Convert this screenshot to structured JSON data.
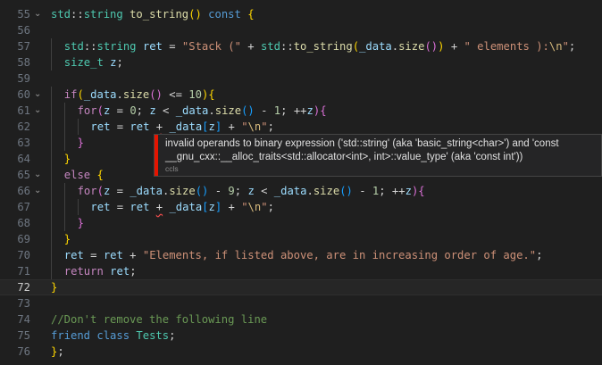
{
  "editor": {
    "current_line": "72",
    "lines": [
      {
        "n": "55",
        "fold": "⌄",
        "indent": 0,
        "tokens": [
          [
            "ns",
            "std"
          ],
          [
            "op",
            "::"
          ],
          [
            "ty",
            "string"
          ],
          [
            "op",
            " "
          ],
          [
            "fn",
            "to_string"
          ],
          [
            "p1",
            "()"
          ],
          [
            "op",
            " "
          ],
          [
            "kw",
            "const"
          ],
          [
            "op",
            " "
          ],
          [
            "p1",
            "{"
          ]
        ]
      },
      {
        "n": "56",
        "fold": "",
        "indent": 0,
        "tokens": []
      },
      {
        "n": "57",
        "fold": "",
        "indent": 1,
        "tokens": [
          [
            "ns",
            "std"
          ],
          [
            "op",
            "::"
          ],
          [
            "ty",
            "string"
          ],
          [
            "op",
            " "
          ],
          [
            "var",
            "ret"
          ],
          [
            "op",
            " = "
          ],
          [
            "str",
            "\"Stack (\""
          ],
          [
            "op",
            " + "
          ],
          [
            "ns",
            "std"
          ],
          [
            "op",
            "::"
          ],
          [
            "fn",
            "to_string"
          ],
          [
            "p1",
            "("
          ],
          [
            "var",
            "_data"
          ],
          [
            "op",
            "."
          ],
          [
            "fn",
            "size"
          ],
          [
            "p2",
            "()"
          ],
          [
            "p1",
            ")"
          ],
          [
            "op",
            " + "
          ],
          [
            "str",
            "\" elements ):"
          ],
          [
            "esc",
            "\\n"
          ],
          [
            "str",
            "\""
          ],
          [
            "op",
            ";"
          ]
        ]
      },
      {
        "n": "58",
        "fold": "",
        "indent": 1,
        "tokens": [
          [
            "ty",
            "size_t"
          ],
          [
            "op",
            " "
          ],
          [
            "var",
            "z"
          ],
          [
            "op",
            ";"
          ]
        ]
      },
      {
        "n": "59",
        "fold": "",
        "indent": 0,
        "tokens": []
      },
      {
        "n": "60",
        "fold": "⌄",
        "indent": 1,
        "tokens": [
          [
            "ctl",
            "if"
          ],
          [
            "p1",
            "("
          ],
          [
            "var",
            "_data"
          ],
          [
            "op",
            "."
          ],
          [
            "fn",
            "size"
          ],
          [
            "p2",
            "()"
          ],
          [
            "op",
            " <= "
          ],
          [
            "num",
            "10"
          ],
          [
            "p1",
            ")"
          ],
          [
            "p1",
            "{"
          ]
        ]
      },
      {
        "n": "61",
        "fold": "⌄",
        "indent": 2,
        "tokens": [
          [
            "ctl",
            "for"
          ],
          [
            "p2",
            "("
          ],
          [
            "var",
            "z"
          ],
          [
            "op",
            " = "
          ],
          [
            "num",
            "0"
          ],
          [
            "op",
            "; "
          ],
          [
            "var",
            "z"
          ],
          [
            "op",
            " < "
          ],
          [
            "var",
            "_data"
          ],
          [
            "op",
            "."
          ],
          [
            "fn",
            "size"
          ],
          [
            "p3",
            "()"
          ],
          [
            "op",
            " - "
          ],
          [
            "num",
            "1"
          ],
          [
            "op",
            "; ++"
          ],
          [
            "var",
            "z"
          ],
          [
            "p2",
            ")"
          ],
          [
            "p2",
            "{"
          ]
        ]
      },
      {
        "n": "62",
        "fold": "",
        "indent": 3,
        "tokens": [
          [
            "var",
            "ret"
          ],
          [
            "op",
            " = "
          ],
          [
            "var",
            "ret"
          ],
          [
            "op",
            " "
          ],
          [
            "sq",
            "+"
          ],
          [
            "op",
            " "
          ],
          [
            "var",
            "_data"
          ],
          [
            "p3",
            "["
          ],
          [
            "var",
            "z"
          ],
          [
            "p3",
            "]"
          ],
          [
            "op",
            " + "
          ],
          [
            "str",
            "\""
          ],
          [
            "esc",
            "\\n"
          ],
          [
            "str",
            "\""
          ],
          [
            "op",
            ";"
          ]
        ]
      },
      {
        "n": "63",
        "fold": "",
        "indent": 2,
        "tokens": [
          [
            "p2",
            "}"
          ]
        ]
      },
      {
        "n": "64",
        "fold": "",
        "indent": 1,
        "tokens": [
          [
            "p1",
            "}"
          ]
        ]
      },
      {
        "n": "65",
        "fold": "⌄",
        "indent": 1,
        "tokens": [
          [
            "ctl",
            "else"
          ],
          [
            "op",
            " "
          ],
          [
            "p1",
            "{"
          ]
        ]
      },
      {
        "n": "66",
        "fold": "⌄",
        "indent": 2,
        "tokens": [
          [
            "ctl",
            "for"
          ],
          [
            "p2",
            "("
          ],
          [
            "var",
            "z"
          ],
          [
            "op",
            " = "
          ],
          [
            "var",
            "_data"
          ],
          [
            "op",
            "."
          ],
          [
            "fn",
            "size"
          ],
          [
            "p3",
            "()"
          ],
          [
            "op",
            " - "
          ],
          [
            "num",
            "9"
          ],
          [
            "op",
            "; "
          ],
          [
            "var",
            "z"
          ],
          [
            "op",
            " < "
          ],
          [
            "var",
            "_data"
          ],
          [
            "op",
            "."
          ],
          [
            "fn",
            "size"
          ],
          [
            "p3",
            "()"
          ],
          [
            "op",
            " - "
          ],
          [
            "num",
            "1"
          ],
          [
            "op",
            "; ++"
          ],
          [
            "var",
            "z"
          ],
          [
            "p2",
            ")"
          ],
          [
            "p2",
            "{"
          ]
        ]
      },
      {
        "n": "67",
        "fold": "",
        "indent": 3,
        "tokens": [
          [
            "var",
            "ret"
          ],
          [
            "op",
            " = "
          ],
          [
            "var",
            "ret"
          ],
          [
            "op",
            " "
          ],
          [
            "sq",
            "+"
          ],
          [
            "op",
            " "
          ],
          [
            "var",
            "_data"
          ],
          [
            "p3",
            "["
          ],
          [
            "var",
            "z"
          ],
          [
            "p3",
            "]"
          ],
          [
            "op",
            " + "
          ],
          [
            "str",
            "\""
          ],
          [
            "esc",
            "\\n"
          ],
          [
            "str",
            "\""
          ],
          [
            "op",
            ";"
          ]
        ]
      },
      {
        "n": "68",
        "fold": "",
        "indent": 2,
        "tokens": [
          [
            "p2",
            "}"
          ]
        ]
      },
      {
        "n": "69",
        "fold": "",
        "indent": 1,
        "tokens": [
          [
            "p1",
            "}"
          ]
        ]
      },
      {
        "n": "70",
        "fold": "",
        "indent": 1,
        "tokens": [
          [
            "var",
            "ret"
          ],
          [
            "op",
            " = "
          ],
          [
            "var",
            "ret"
          ],
          [
            "op",
            " + "
          ],
          [
            "str",
            "\"Elements, if listed above, are in increasing order of age.\""
          ],
          [
            "op",
            ";"
          ]
        ]
      },
      {
        "n": "71",
        "fold": "",
        "indent": 1,
        "tokens": [
          [
            "ctl",
            "return"
          ],
          [
            "op",
            " "
          ],
          [
            "var",
            "ret"
          ],
          [
            "op",
            ";"
          ]
        ]
      },
      {
        "n": "72",
        "fold": "",
        "indent": 0,
        "tokens": [
          [
            "p1",
            "}"
          ]
        ]
      },
      {
        "n": "73",
        "fold": "",
        "indent": 0,
        "tokens": []
      },
      {
        "n": "74",
        "fold": "",
        "indent": 0,
        "tokens": [
          [
            "cmt",
            "//Don't remove the following line"
          ]
        ]
      },
      {
        "n": "75",
        "fold": "",
        "indent": 0,
        "tokens": [
          [
            "kw",
            "friend"
          ],
          [
            "op",
            " "
          ],
          [
            "kw",
            "class"
          ],
          [
            "op",
            " "
          ],
          [
            "ty",
            "Tests"
          ],
          [
            "op",
            ";"
          ]
        ]
      },
      {
        "n": "76",
        "fold": "",
        "indent": 0,
        "tokens": [
          [
            "p1",
            "}"
          ],
          [
            "op",
            ";"
          ]
        ]
      }
    ]
  },
  "tooltip": {
    "message": "invalid operands to binary expression ('std::string' (aka 'basic_string<char>') and 'const __gnu_cxx::__alloc_traits<std::allocator<int>, int>::value_type' (aka 'const int'))",
    "source": "ccls",
    "severity_color": "#e51400"
  },
  "colors": {
    "background": "#1f1f1f",
    "keyword": "#569cd6",
    "type": "#4ec9b0",
    "function": "#dcdcaa",
    "variable": "#9cdcfe",
    "string": "#ce9178",
    "number": "#b5cea8",
    "comment": "#6a9955",
    "error": "#f14c4c"
  }
}
